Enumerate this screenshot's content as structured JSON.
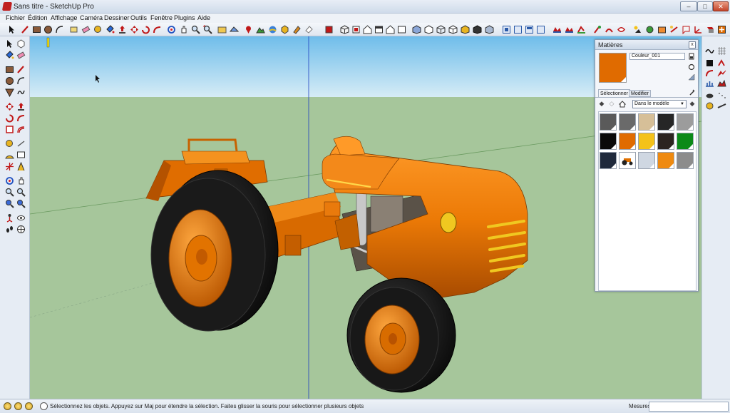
{
  "window": {
    "title": "Sans titre - SketchUp Pro",
    "min": "–",
    "max": "□",
    "close": "✕"
  },
  "menu": [
    "Fichier",
    "Édition",
    "Affichage",
    "Caméra",
    "Dessiner",
    "Outils",
    "Fenêtre",
    "Plugins",
    "Aide"
  ],
  "status": {
    "text": "Sélectionnez les objets. Appuyez sur Maj pour étendre la sélection. Faites glisser la souris pour sélectionner plusieurs objets",
    "measure_label": "Mesures",
    "measure_value": ""
  },
  "materials_panel": {
    "title": "Matières",
    "close": "x",
    "current_material": "Couleur_001",
    "current_color": "#e06b00",
    "tabs": [
      "Sélectionner",
      "Modifier"
    ],
    "library": "Dans le modèle",
    "swatches": [
      "#5a5a5a",
      "#6a6a6a",
      "#d6bf98",
      "#262626",
      "#9c9c9c",
      "#0a0a0a",
      "#e06b00",
      "#f4c21a",
      "#2c2420",
      "#0c8a18",
      "#202a3c",
      "tractor-thumbnail",
      "#cfd7e2",
      "#ef8a10",
      "#8c8c8c"
    ]
  },
  "colors": {
    "sky": "#7fc4ec",
    "ground": "#a5c59a",
    "orange": "#e87400",
    "tire": "#151515"
  }
}
